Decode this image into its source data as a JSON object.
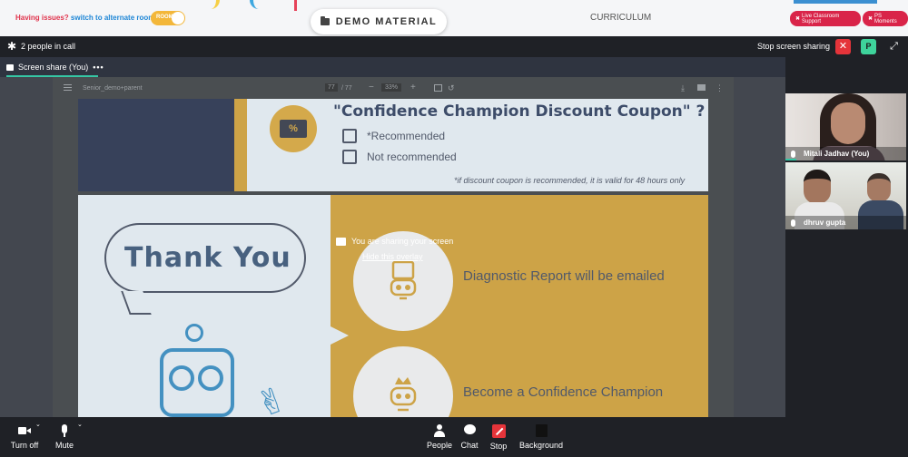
{
  "top": {
    "issues_text": "Having issues?",
    "alt_room_text": "switch to alternate room",
    "toggle_label": "ROOM",
    "demo_label": "DEMO MATERIAL",
    "curriculum_label": "CURRICULUM",
    "live_support_label": "Live Classroom Support",
    "ps_moments_label": "PS Moments"
  },
  "call": {
    "people_count": "2 people in call",
    "stop_sharing_label": "Stop screen sharing",
    "close_glyph": "✕",
    "avatar_letter": "P"
  },
  "share_tab": {
    "label": "Screen share (You)",
    "more_glyph": "•••"
  },
  "pdf": {
    "filename": "Senior_demo+parent",
    "page_current": "77",
    "page_total": "/ 77",
    "zoom": "33%",
    "coupon_question": "\"Confidence Champion Discount Coupon\" ?",
    "coupon_symbol": "%",
    "option_recommended": "*Recommended",
    "option_not": "Not recommended",
    "validity_note": "*if discount coupon is recommended, it is valid for 48 hours only",
    "thank_you": "Thank You",
    "diagnostic": "Diagnostic Report will be emailed",
    "champion": "Become a Confidence Champion"
  },
  "overlay": {
    "message": "You are sharing your screen",
    "hide_link": "Hide this overlay"
  },
  "participants": [
    {
      "name": "Mitali Jadhav (You)"
    },
    {
      "name": "dhruv gupta"
    }
  ],
  "controls": {
    "camera_label": "Turn off",
    "mute_label": "Mute",
    "people_label": "People",
    "chat_label": "Chat",
    "stop_label": "Stop",
    "background_label": "Background"
  },
  "colors": {
    "accent_green": "#35c7a5",
    "danger_red": "#e5343a",
    "brand_pink": "#d92449",
    "slide_gold": "#c6972e",
    "slide_navy": "#1c2744"
  },
  "icons": [
    "gear-icon",
    "screen-share-icon",
    "close-icon",
    "fullscreen-icon",
    "folder-icon",
    "camera-icon",
    "mic-icon",
    "people-icon",
    "chat-icon",
    "stop-share-icon",
    "background-icon"
  ]
}
